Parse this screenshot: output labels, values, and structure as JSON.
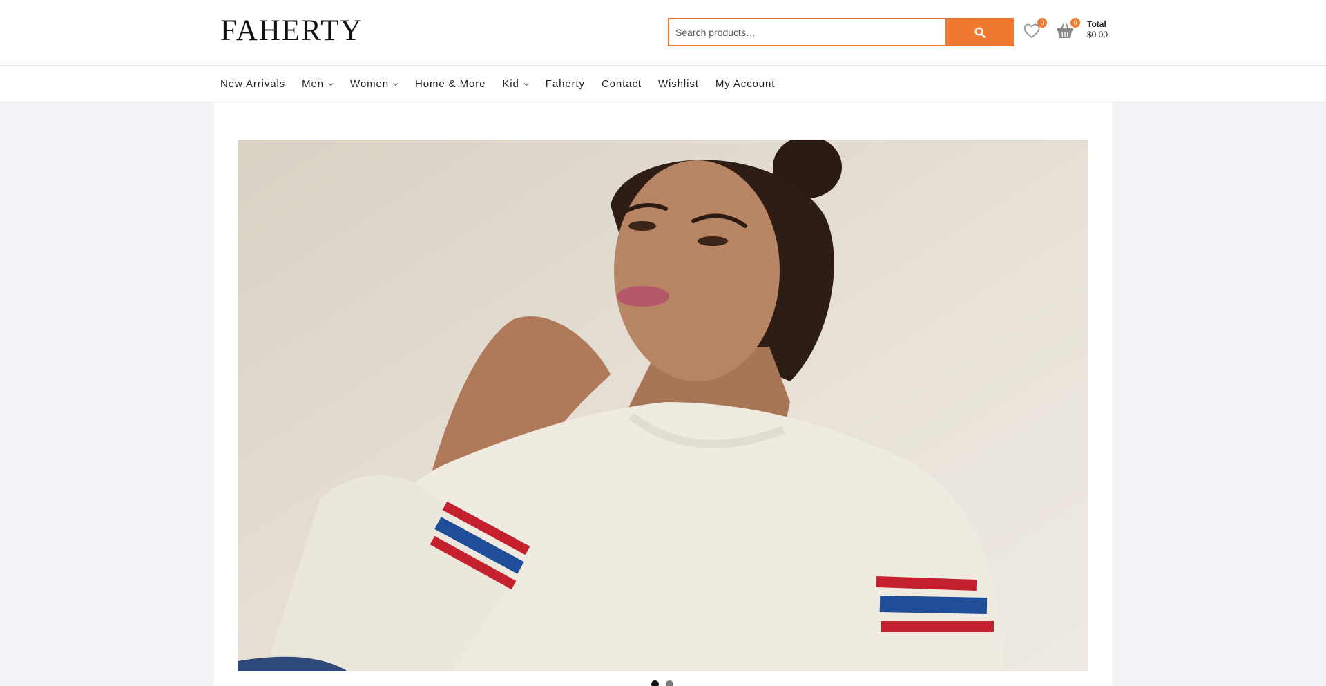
{
  "header": {
    "logo": "FAHERTY",
    "search": {
      "placeholder": "Search products…",
      "value": ""
    },
    "wishlist": {
      "count": "0",
      "icon": "heart-icon"
    },
    "cart": {
      "count": "0",
      "icon": "basket-icon",
      "total_label": "Total",
      "total_value": "$0.00"
    }
  },
  "nav": {
    "items": [
      {
        "label": "New Arrivals",
        "dropdown": false
      },
      {
        "label": "Men",
        "dropdown": true
      },
      {
        "label": "Women",
        "dropdown": true
      },
      {
        "label": "Home & More",
        "dropdown": false
      },
      {
        "label": "Kid",
        "dropdown": true
      },
      {
        "label": "Faherty",
        "dropdown": false
      },
      {
        "label": "Contact",
        "dropdown": false
      },
      {
        "label": "Wishlist",
        "dropdown": false
      },
      {
        "label": "My Account",
        "dropdown": false
      }
    ]
  },
  "hero": {
    "slide_count": 2,
    "active_slide": 1
  },
  "colors": {
    "accent": "#f07830",
    "page_bg": "#f1f3f7",
    "text": "#222222"
  }
}
